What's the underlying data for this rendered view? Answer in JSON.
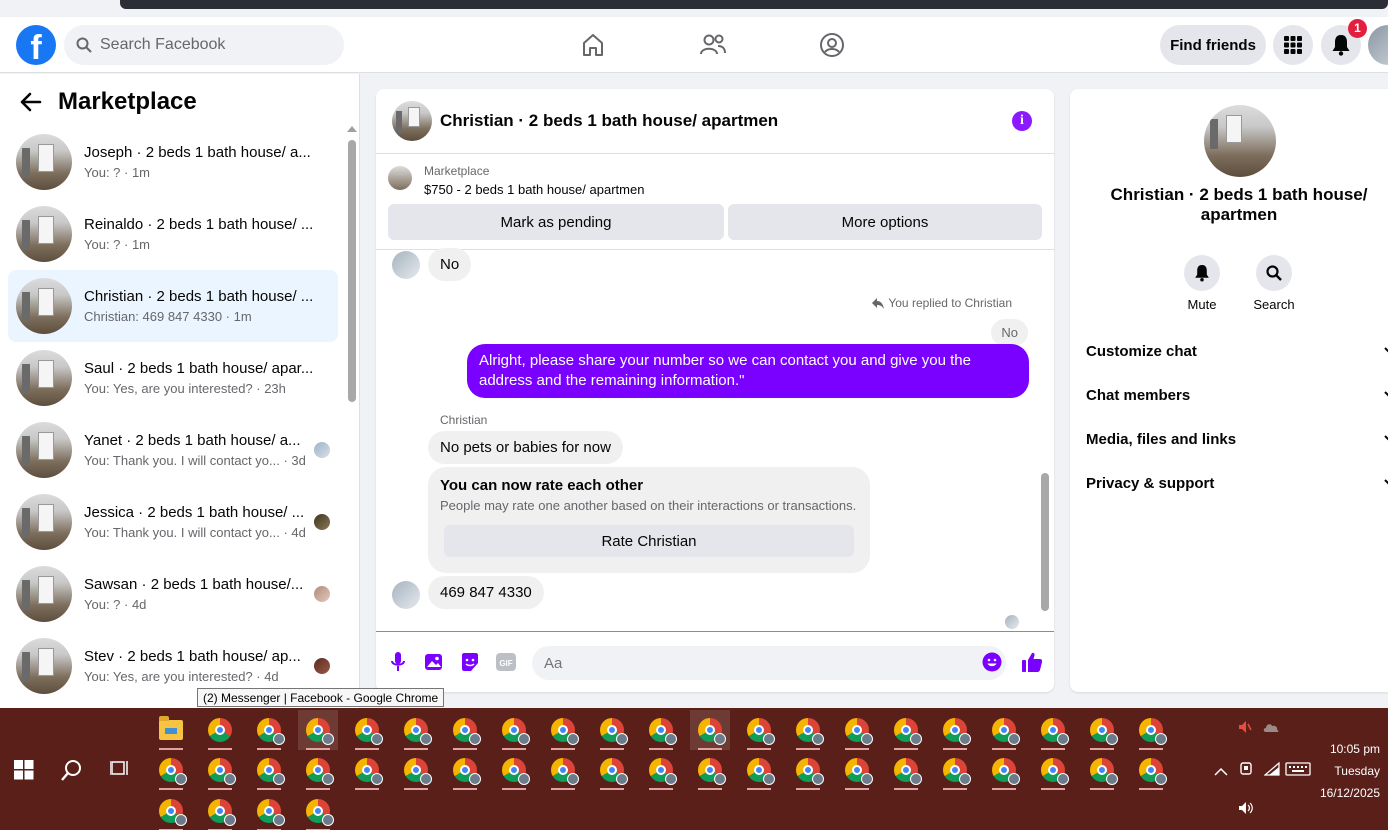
{
  "header": {
    "search_placeholder": "Search Facebook",
    "find_friends": "Find friends",
    "notif_count": "1"
  },
  "sidebar": {
    "title": "Marketplace",
    "conversations": [
      {
        "name": "Joseph · 2 beds 1 bath house/ a...",
        "sub": "You: ? · 1m"
      },
      {
        "name": "Reinaldo · 2 beds 1 bath house/ ...",
        "sub": "You: ? · 1m"
      },
      {
        "name": "Christian · 2 beds 1 bath house/ ...",
        "sub": "Christian: 469 847 4330 · 1m"
      },
      {
        "name": "Saul · 2 beds 1 bath house/ apar...",
        "sub": "You: Yes, are you interested? · 23h"
      },
      {
        "name": "Yanet · 2 beds 1 bath house/ a...",
        "sub": "You: Thank you. I will contact yo... · 3d"
      },
      {
        "name": "Jessica · 2 beds 1 bath house/ ...",
        "sub": "You: Thank you. I will contact yo... · 4d"
      },
      {
        "name": "Sawsan · 2 beds 1 bath house/...",
        "sub": "You: ? · 4d"
      },
      {
        "name": "Stev · 2 beds 1 bath house/ ap...",
        "sub": "You: Yes, are you interested? · 4d"
      }
    ]
  },
  "chat": {
    "title": "Christian · 2 beds 1 bath house/ apartmen",
    "marketplace_label": "Marketplace",
    "listing": "$750 - 2 beds 1 bath house/ apartmen",
    "mark_pending": "Mark as pending",
    "more_options": "More options",
    "messages": {
      "m1": "No",
      "replied_note": "You replied to Christian",
      "quoted": "No",
      "m2": "Alright, please share your number so we can contact you and give you the address and the remaining information.\"",
      "sender": "Christian",
      "m3": "No pets or babies for now",
      "rate_title": "You can now rate each other",
      "rate_sub": "People may rate one another based on their interactions or transactions.",
      "rate_btn": "Rate Christian",
      "m4": "469 847 4330"
    },
    "composer_placeholder": "Aa"
  },
  "info": {
    "name": "Christian · 2 beds 1 bath house/ apartmen",
    "mute": "Mute",
    "search": "Search",
    "rows": [
      "Customize chat",
      "Chat members",
      "Media, files and links",
      "Privacy & support"
    ]
  },
  "tooltip": "(2) Messenger | Facebook - Google Chrome",
  "taskbar": {
    "time": "10:05 pm",
    "day": "Tuesday",
    "date": "16/12/2025"
  },
  "colors": {
    "brand": "#1877f2",
    "accent": "#7a00ff",
    "taskbar": "#5a1f19"
  }
}
